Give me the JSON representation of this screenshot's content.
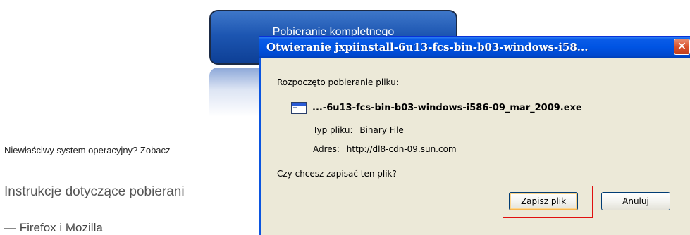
{
  "background_page": {
    "download_button_label": "Pobieranie kompletnego",
    "wrong_os_text": "Niewłaściwy system operacyjny? Zobacz",
    "instructions_heading": "Instrukcje dotyczące pobierani",
    "firefox_line": "— Firefox i Mozilla"
  },
  "dialog": {
    "title": "Otwieranie jxpiinstall-6u13-fcs-bin-b03-windows-i58...",
    "close_glyph": "✕",
    "prompt_start": "Rozpoczęto pobieranie pliku:",
    "file_name": "...-6u13-fcs-bin-b03-windows-i586-09_mar_2009.exe",
    "type_label": "Typ pliku:",
    "type_value": "Binary File",
    "address_label": "Adres:",
    "address_value": "http://dl8-cdn-09.sun.com",
    "question": "Czy chcesz zapisać ten plik?",
    "save_button": "Zapisz plik",
    "cancel_button": "Anuluj",
    "icons": {
      "file": "application-window-icon",
      "close": "close-icon"
    }
  },
  "colors": {
    "titlebar": "#0054e3",
    "dialog_body": "#ece9d8",
    "close_button": "#d9512c",
    "download_button": "#1d56b2",
    "highlight_box": "#e01010"
  }
}
